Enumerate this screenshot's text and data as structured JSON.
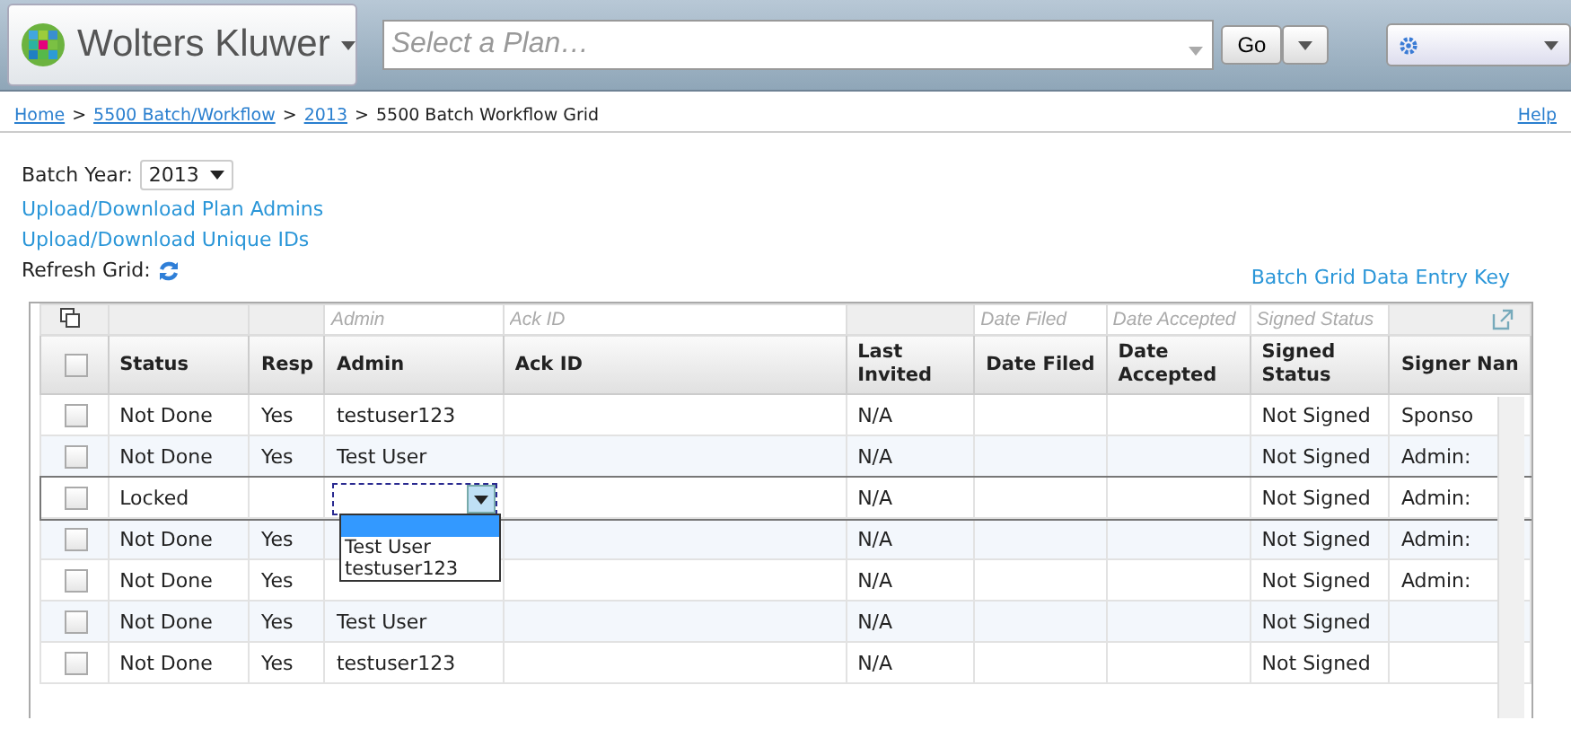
{
  "header": {
    "brand": "Wolters Kluwer",
    "plan_search": {
      "placeholder": "Select a Plan…"
    },
    "go_button": "Go"
  },
  "breadcrumb": {
    "links": [
      "Home",
      "5500 Batch/Workflow",
      "2013"
    ],
    "current": "5500 Batch Workflow Grid",
    "separator": ">",
    "help": "Help"
  },
  "batch_year": {
    "label": "Batch Year:",
    "value": "2013"
  },
  "links": [
    "Upload/Download Plan Admins",
    "Upload/Download Unique IDs"
  ],
  "refresh": {
    "label": "Refresh Grid:"
  },
  "key_link": "Batch Grid Data Entry Key",
  "grid": {
    "columns": [
      {
        "kind": "check"
      },
      {
        "kind": "text",
        "label": "Status"
      },
      {
        "kind": "text",
        "label": "Resp"
      },
      {
        "kind": "text",
        "label": "Admin",
        "placeholder": "Admin"
      },
      {
        "kind": "text",
        "label": "Ack ID",
        "placeholder": "Ack ID"
      },
      {
        "kind": "text",
        "label": "Last Invited"
      },
      {
        "kind": "text",
        "label": "Date Filed",
        "placeholder": "Date Filed"
      },
      {
        "kind": "text",
        "label": "Date Accepted",
        "placeholder": "Date Accepted"
      },
      {
        "kind": "text",
        "label": "Signed Status",
        "placeholder": "Signed Status"
      },
      {
        "kind": "text",
        "label": "Signer Nan"
      }
    ],
    "select_all": {
      "checked": false
    },
    "rows": [
      {
        "checked": false,
        "cells": [
          "",
          "Not Done",
          "Yes",
          "testuser123",
          "",
          "N/A",
          "",
          "",
          "Not Signed",
          "Sponso"
        ]
      },
      {
        "checked": false,
        "cells": [
          "",
          "Not Done",
          "Yes",
          "Test User",
          "",
          "N/A",
          "",
          "",
          "Not Signed",
          "Admin:"
        ]
      },
      {
        "checked": false,
        "editing": true,
        "cells": [
          "",
          "Locked",
          "",
          "",
          "",
          "N/A",
          "",
          "",
          "Not Signed",
          "Admin:"
        ],
        "editor": {
          "options": [
            {
              "selected": true
            },
            {
              "label": "Test User",
              "selected": false
            },
            {
              "label": "testuser123",
              "selected": false
            }
          ]
        }
      },
      {
        "checked": false,
        "cells": [
          "",
          "Not Done",
          "Yes",
          "",
          "",
          "N/A",
          "",
          "",
          "Not Signed",
          "Admin:"
        ]
      },
      {
        "checked": false,
        "cells": [
          "",
          "Not Done",
          "Yes",
          "",
          "",
          "N/A",
          "",
          "",
          "Not Signed",
          "Admin:"
        ]
      },
      {
        "checked": false,
        "cells": [
          "",
          "Not Done",
          "Yes",
          "Test User",
          "",
          "N/A",
          "",
          "",
          "Not Signed",
          ""
        ]
      },
      {
        "checked": false,
        "cells": [
          "",
          "Not Done",
          "Yes",
          "testuser123",
          "",
          "N/A",
          "",
          "",
          "Not Signed",
          ""
        ]
      }
    ]
  }
}
